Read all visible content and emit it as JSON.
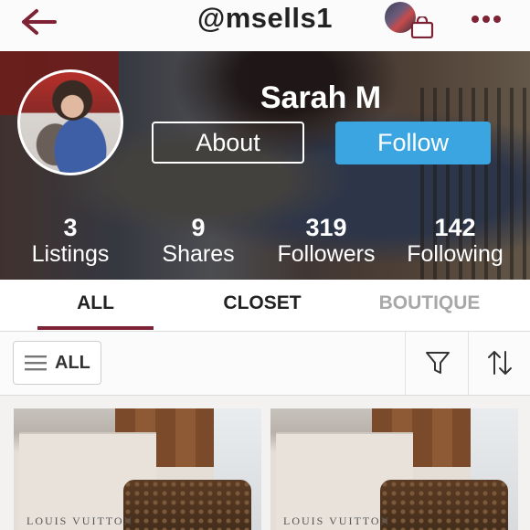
{
  "header": {
    "handle": "@msells1",
    "back_icon": "back-arrow-icon",
    "bag_icon": "shopping-bag-icon",
    "more_icon": "more-dots-icon",
    "accent_color": "#7d2335"
  },
  "profile": {
    "name": "Sarah M",
    "about_label": "About",
    "follow_label": "Follow",
    "follow_color": "#3aa5e0",
    "stats": [
      {
        "value": "3",
        "label": "Listings"
      },
      {
        "value": "9",
        "label": "Shares"
      },
      {
        "value": "319",
        "label": "Followers"
      },
      {
        "value": "142",
        "label": "Following"
      }
    ]
  },
  "tabs": [
    {
      "label": "ALL",
      "active": true
    },
    {
      "label": "CLOSET",
      "active": false
    },
    {
      "label": "BOUTIQUE",
      "active": false
    }
  ],
  "filterbar": {
    "all_label": "ALL",
    "filter_icon": "filter-funnel-icon",
    "sort_icon": "sort-arrows-icon"
  },
  "listings": [
    {
      "brand_text": "LOUIS VUITTON"
    },
    {
      "brand_text": "LOUIS VUITTON"
    }
  ]
}
